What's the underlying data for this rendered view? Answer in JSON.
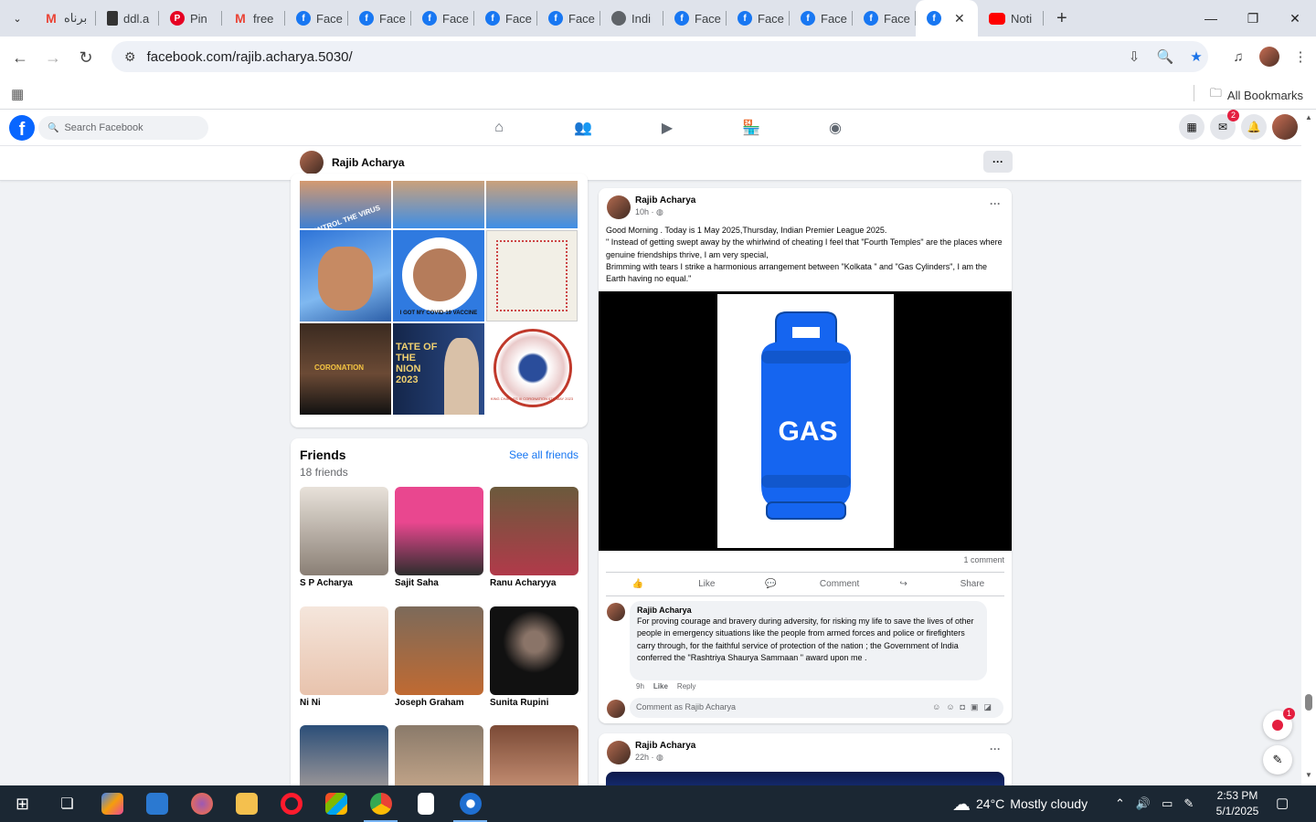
{
  "browser": {
    "tabs": [
      {
        "icon": "gmail-icon",
        "title": "برناه"
      },
      {
        "icon": "doc-icon",
        "title": "ddl.a"
      },
      {
        "icon": "pinterest-icon",
        "title": "Pin"
      },
      {
        "icon": "gmail-icon",
        "title": "free"
      },
      {
        "icon": "facebook-icon",
        "title": "Face"
      },
      {
        "icon": "facebook-icon",
        "title": "Face"
      },
      {
        "icon": "facebook-icon",
        "title": "Face"
      },
      {
        "icon": "facebook-icon",
        "title": "Face"
      },
      {
        "icon": "facebook-icon",
        "title": "Face"
      },
      {
        "icon": "globe-icon",
        "title": "Indi"
      },
      {
        "icon": "facebook-icon",
        "title": "Face"
      },
      {
        "icon": "facebook-icon",
        "title": "Face"
      },
      {
        "icon": "facebook-icon",
        "title": "Face"
      },
      {
        "icon": "facebook-icon",
        "title": "Face"
      },
      {
        "icon": "facebook-icon",
        "title": "Face"
      }
    ],
    "active_tab_close": "✕",
    "last_tab": {
      "icon": "youtube-icon",
      "title": "Noti"
    },
    "url": "facebook.com/rajib.acharya.5030/",
    "all_bookmarks": "All Bookmarks"
  },
  "facebook": {
    "search_placeholder": "Search Facebook",
    "messenger_badge": "2",
    "profile_name": "Rajib Acharya",
    "friends": {
      "title": "Friends",
      "count": "18 friends",
      "see_all": "See all friends",
      "list": [
        {
          "name": "S P Acharya"
        },
        {
          "name": "Sajit Saha"
        },
        {
          "name": "Ranu Acharyya"
        },
        {
          "name": "Ni Ni"
        },
        {
          "name": "Joseph Graham"
        },
        {
          "name": "Sunita Rupini"
        }
      ]
    },
    "photos": {
      "tile_texts": [
        "CONTROL THE VIRUS",
        "I GOT MY COVID-19 VACCINE",
        "CORONATION",
        "TATE OF THE NION 2023",
        "KING CHARLES III CORONATION 6TH MAY 2023"
      ]
    },
    "post1": {
      "author": "Rajib Acharya",
      "time": "10h ·",
      "text_lines": [
        "Good Morning . Today is 1 May 2025,Thursday, Indian Premier League 2025.",
        "\" Instead of getting swept away by the whirlwind of cheating I feel that \"Fourth Temples\" are the places where genuine friendships thrive, I am very special,",
        "Brimming with tears I strike a harmonious arrangement between \"Kolkata \" and \"Gas Cylinders\", I am the Earth having no equal.\""
      ],
      "image_text": "GAS",
      "comment_count": "1 comment",
      "like": "Like",
      "comment": "Comment",
      "share": "Share",
      "comment_item": {
        "author": "Rajib Acharya",
        "text": "For proving courage and bravery during adversity, for risking my life to save the lives of other people in emergency situations like the people from armed forces and police or firefighters carry through, for the faithful service of protection of the nation ; the Government of India conferred the \"Rashtriya Shaurya Sammaan \" award upon me .",
        "time": "9h",
        "like": "Like",
        "reply": "Reply"
      },
      "write_placeholder": "Comment as Rajib Acharya"
    },
    "post2": {
      "author": "Rajib Acharya",
      "time": "22h ·"
    },
    "float_badge": "1"
  },
  "taskbar": {
    "weather_temp": "24°C",
    "weather_desc": "Mostly cloudy",
    "time": "2:53 PM",
    "date": "5/1/2025"
  },
  "colors": {
    "facebook_blue": "#0866ff",
    "link_blue": "#1877f2",
    "gas_blue": "#1565f0"
  }
}
